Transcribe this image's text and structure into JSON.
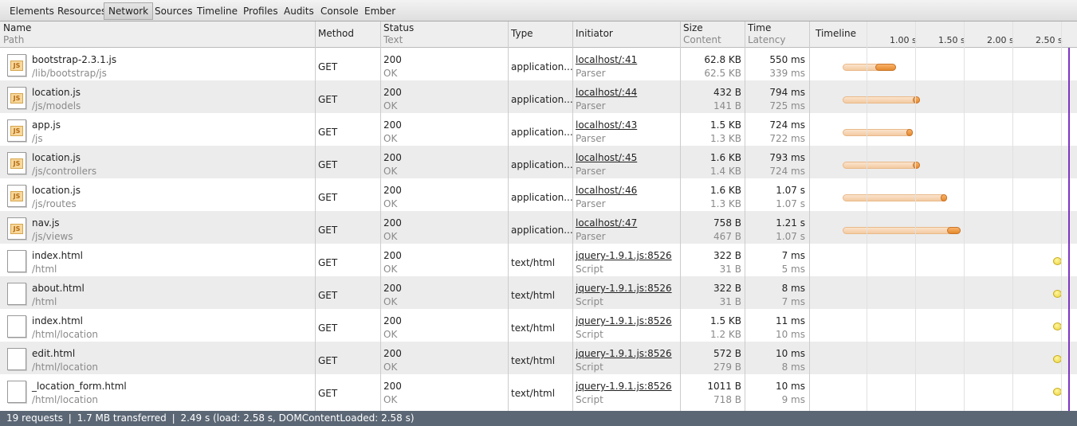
{
  "tabs": [
    "Elements",
    "Resources",
    "Network",
    "Sources",
    "Timeline",
    "Profiles",
    "Audits",
    "Console",
    "Ember"
  ],
  "active_tab": "Network",
  "columns": {
    "name": {
      "top": "Name",
      "bottom": "Path"
    },
    "method": {
      "top": "Method"
    },
    "status": {
      "top": "Status",
      "bottom": "Text"
    },
    "type": {
      "top": "Type"
    },
    "initiator": {
      "top": "Initiator"
    },
    "size": {
      "top": "Size",
      "bottom": "Content"
    },
    "time": {
      "top": "Time",
      "bottom": "Latency"
    },
    "timeline": {
      "top": "Timeline"
    }
  },
  "timeline_ticks": [
    "1.00 s",
    "1.50 s",
    "2.00 s",
    "2.50 s"
  ],
  "requests": [
    {
      "name": "bootstrap-2.3.1.js",
      "path": "/lib/bootstrap/js",
      "method": "GET",
      "status": "200",
      "status_text": "OK",
      "type": "application...",
      "initiator": "localhost/:41",
      "initiator_type": "Parser",
      "size": "62.8 KB",
      "content": "62.5 KB",
      "time": "550 ms",
      "latency": "339 ms",
      "icon": "js-file-icon",
      "wait_end": 0.339,
      "end": 0.55,
      "start": 0
    },
    {
      "name": "location.js",
      "path": "/js/models",
      "method": "GET",
      "status": "200",
      "status_text": "OK",
      "type": "application...",
      "initiator": "localhost/:44",
      "initiator_type": "Parser",
      "size": "432 B",
      "content": "141 B",
      "time": "794 ms",
      "latency": "725 ms",
      "icon": "js-file-icon",
      "wait_end": 0.725,
      "end": 0.794,
      "start": 0
    },
    {
      "name": "app.js",
      "path": "/js",
      "method": "GET",
      "status": "200",
      "status_text": "OK",
      "type": "application...",
      "initiator": "localhost/:43",
      "initiator_type": "Parser",
      "size": "1.5 KB",
      "content": "1.3 KB",
      "time": "724 ms",
      "latency": "722 ms",
      "icon": "js-file-icon",
      "wait_end": 0.722,
      "end": 0.724,
      "start": 0
    },
    {
      "name": "location.js",
      "path": "/js/controllers",
      "method": "GET",
      "status": "200",
      "status_text": "OK",
      "type": "application...",
      "initiator": "localhost/:45",
      "initiator_type": "Parser",
      "size": "1.6 KB",
      "content": "1.4 KB",
      "time": "793 ms",
      "latency": "724 ms",
      "icon": "js-file-icon",
      "wait_end": 0.724,
      "end": 0.793,
      "start": 0
    },
    {
      "name": "location.js",
      "path": "/js/routes",
      "method": "GET",
      "status": "200",
      "status_text": "OK",
      "type": "application...",
      "initiator": "localhost/:46",
      "initiator_type": "Parser",
      "size": "1.6 KB",
      "content": "1.3 KB",
      "time": "1.07 s",
      "latency": "1.07 s",
      "icon": "js-file-icon",
      "wait_end": 1.07,
      "end": 1.07,
      "start": 0
    },
    {
      "name": "nav.js",
      "path": "/js/views",
      "method": "GET",
      "status": "200",
      "status_text": "OK",
      "type": "application...",
      "initiator": "localhost/:47",
      "initiator_type": "Parser",
      "size": "758 B",
      "content": "467 B",
      "time": "1.21 s",
      "latency": "1.07 s",
      "icon": "js-file-icon",
      "wait_end": 1.07,
      "end": 1.21,
      "start": 0
    },
    {
      "name": "index.html",
      "path": "/html",
      "method": "GET",
      "status": "200",
      "status_text": "OK",
      "type": "text/html",
      "initiator": "jquery-1.9.1.js:8526",
      "initiator_type": "Script",
      "size": "322 B",
      "content": "31 B",
      "time": "7 ms",
      "latency": "5 ms",
      "icon": "html-file-icon",
      "start": 2.25
    },
    {
      "name": "about.html",
      "path": "/html",
      "method": "GET",
      "status": "200",
      "status_text": "OK",
      "type": "text/html",
      "initiator": "jquery-1.9.1.js:8526",
      "initiator_type": "Script",
      "size": "322 B",
      "content": "31 B",
      "time": "8 ms",
      "latency": "7 ms",
      "icon": "html-file-icon",
      "start": 2.25
    },
    {
      "name": "index.html",
      "path": "/html/location",
      "method": "GET",
      "status": "200",
      "status_text": "OK",
      "type": "text/html",
      "initiator": "jquery-1.9.1.js:8526",
      "initiator_type": "Script",
      "size": "1.5 KB",
      "content": "1.2 KB",
      "time": "11 ms",
      "latency": "10 ms",
      "icon": "html-file-icon",
      "start": 2.25
    },
    {
      "name": "edit.html",
      "path": "/html/location",
      "method": "GET",
      "status": "200",
      "status_text": "OK",
      "type": "text/html",
      "initiator": "jquery-1.9.1.js:8526",
      "initiator_type": "Script",
      "size": "572 B",
      "content": "279 B",
      "time": "10 ms",
      "latency": "8 ms",
      "icon": "html-file-icon",
      "start": 2.25
    },
    {
      "name": "_location_form.html",
      "path": "/html/location",
      "method": "GET",
      "status": "200",
      "status_text": "OK",
      "type": "text/html",
      "initiator": "jquery-1.9.1.js:8526",
      "initiator_type": "Script",
      "size": "1011 B",
      "content": "718 B",
      "time": "10 ms",
      "latency": "9 ms",
      "icon": "html-file-icon",
      "start": 2.25
    }
  ],
  "status_bar": "19 requests  ❘  1.7 MB transferred  ❘  2.49 s (load: 2.58 s, DOMContentLoaded: 2.58 s)"
}
